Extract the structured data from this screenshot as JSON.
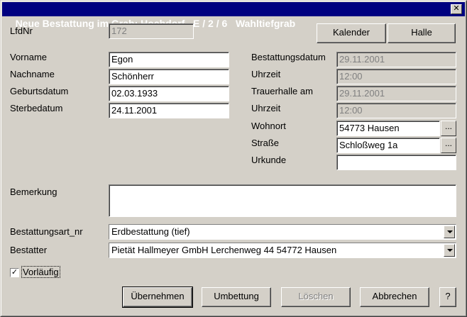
{
  "window": {
    "title": "Neue Bestattung im Grab: Hochdorf   E / 2 / 6   Wahltiefgrab",
    "close_glyph": "✕"
  },
  "labels": {
    "lfdnr": "LfdNr",
    "vorname": "Vorname",
    "nachname": "Nachname",
    "geburtsdatum": "Geburtsdatum",
    "sterbedatum": "Sterbedatum",
    "bestattungsdatum": "Bestattungsdatum",
    "uhrzeit1": "Uhrzeit",
    "trauerhalle": "Trauerhalle am",
    "uhrzeit2": "Uhrzeit",
    "wohnort": "Wohnort",
    "strasse": "Straße",
    "urkunde": "Urkunde",
    "bemerkung": "Bemerkung",
    "bestattungsart": "Bestattungsart_nr",
    "bestatter": "Bestatter"
  },
  "values": {
    "lfdnr": "172",
    "vorname": "Egon",
    "nachname": "Schönherr",
    "geburtsdatum": "02.03.1933",
    "sterbedatum": "24.11.2001",
    "bestattungsdatum": "29.11.2001",
    "uhrzeit1": "12:00",
    "trauerhalle": "29.11.2001",
    "uhrzeit2": "12:00",
    "wohnort": "54773 Hausen",
    "strasse": "Schloßweg 1a",
    "urkunde": "",
    "bemerkung": "",
    "bestattungsart": "Erdbestattung (tief)",
    "bestatter": "Pietät Hallmeyer GmbH  Lerchenweg 44   54772 Hausen"
  },
  "buttons": {
    "kalender": "Kalender",
    "halle": "Halle",
    "browse": "...",
    "uebernehmen": "Übernehmen",
    "umbettung": "Umbettung",
    "loeschen": "Löschen",
    "abbrechen": "Abbrechen",
    "help": "?"
  },
  "checkbox": {
    "label": "Vorläufig",
    "checked": true,
    "mark": "✓"
  }
}
